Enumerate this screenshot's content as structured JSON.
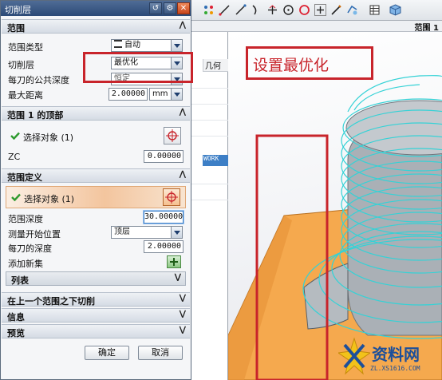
{
  "dialog": {
    "title": "切削层"
  },
  "sections": {
    "range": "范围",
    "range1_top": "范围 1 的顶部",
    "range_def": "范围定义",
    "below_range": "在上一个范围之下切削",
    "info": "信息",
    "preview": "预览"
  },
  "range": {
    "type_label": "范围类型",
    "type_value": "自动",
    "cut_label": "切削层",
    "cut_value": "最优化",
    "common_depth_label": "每刀的公共深度",
    "common_depth_value": "恒定",
    "max_dist_label": "最大距离",
    "max_dist_value": "2.00000",
    "max_dist_unit": "mm"
  },
  "range1_top": {
    "select_label": "选择对象 (1)",
    "zc_label": "ZC",
    "zc_value": "0.00000"
  },
  "range_def": {
    "select_label": "选择对象 (1)",
    "depth_label": "范围深度",
    "depth_value": "30.00000",
    "measure_label": "测量开始位置",
    "measure_value": "顶层",
    "per_cut_label": "每刀的深度",
    "per_cut_value": "2.00000",
    "add_label": "添加新集",
    "list_label": "列表"
  },
  "buttons": {
    "ok": "确定",
    "cancel": "取消"
  },
  "background": {
    "range_tab": "范围 1",
    "column_head": "几何",
    "selected_cell": "WORK"
  },
  "annotation": {
    "text": "设置最优化"
  },
  "watermark": {
    "title": "资料网",
    "url": "ZL.XS1616.COM"
  },
  "colors": {
    "annotation_red": "#c8242b",
    "title_bar": "#2c4a77",
    "highlight_orange": "#f3c59e",
    "part_orange": "#f5a94e",
    "toolpath_cyan": "#35d2d6",
    "watermark_blue": "#1d4f9a"
  }
}
